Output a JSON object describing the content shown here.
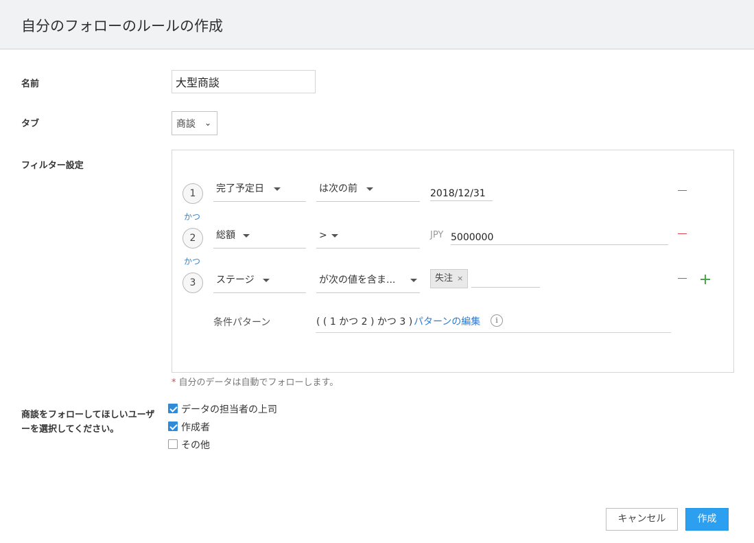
{
  "header": {
    "title": "自分のフォローのルールの作成"
  },
  "form": {
    "name": {
      "label": "名前",
      "value": "大型商談"
    },
    "tab": {
      "label": "タブ",
      "value": "商談",
      "chevron_icon": "chevron-down-icon"
    },
    "filter": {
      "label": "フィルター設定",
      "conditions": [
        {
          "num": "1",
          "field": "完了予定日",
          "operator": "は次の前",
          "prefix": "",
          "value": "2018/12/31"
        },
        {
          "num": "2",
          "field": "総額",
          "operator": ">",
          "prefix": "JPY",
          "value": "5000000"
        },
        {
          "num": "3",
          "field": "ステージ",
          "operator": "が次の値を含ま...",
          "prefix": "",
          "tags": [
            "失注"
          ]
        }
      ],
      "conjunctions": [
        "かつ",
        "かつ"
      ],
      "pattern_label": "条件パターン",
      "pattern": "( ( 1 かつ 2 ) かつ 3 )",
      "pattern_edit": "パターンの編集",
      "info_icon": "i"
    },
    "note": "自分のデータは自動でフォローします。",
    "followers": {
      "label": "商談をフォローしてほしいユーザーを選択してください。",
      "options": [
        {
          "label": "データの担当者の上司",
          "checked": true
        },
        {
          "label": "作成者",
          "checked": true
        },
        {
          "label": "その他",
          "checked": false
        }
      ]
    }
  },
  "buttons": {
    "cancel": "キャンセル",
    "create": "作成"
  },
  "colors": {
    "primary": "#2c9ff0",
    "link": "#2e7bd1",
    "remove": "#d9434e",
    "add": "#4aa64a"
  }
}
